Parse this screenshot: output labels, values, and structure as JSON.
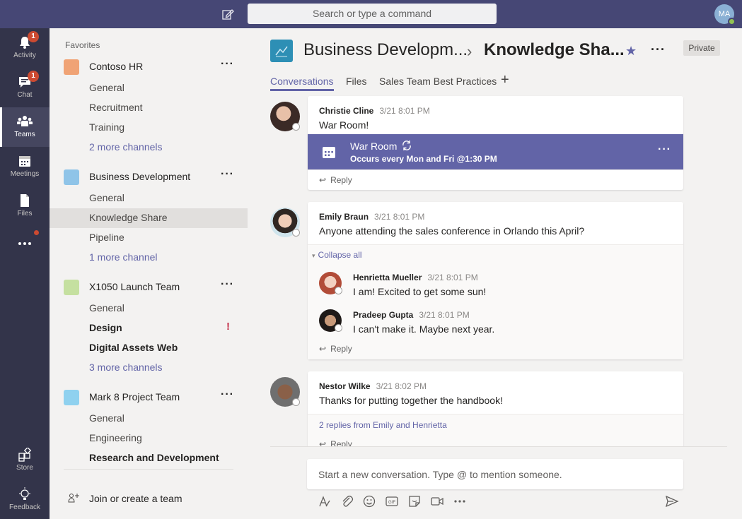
{
  "topbar": {
    "search_placeholder": "Search or type a command",
    "me_initials": "MA"
  },
  "rail": {
    "items": [
      {
        "label": "Activity",
        "badge": "1"
      },
      {
        "label": "Chat",
        "badge": "1"
      },
      {
        "label": "Teams"
      },
      {
        "label": "Meetings"
      },
      {
        "label": "Files"
      },
      {
        "label": "Store"
      },
      {
        "label": "Feedback"
      }
    ]
  },
  "sidebar": {
    "favorites_label": "Favorites",
    "teams": [
      {
        "name": "Contoso HR",
        "color": "#f0a375",
        "channels": [
          "General",
          "Recruitment",
          "Training"
        ],
        "more": "2 more channels"
      },
      {
        "name": "Business Development",
        "color": "#8fc4e8",
        "channels": [
          "General",
          "Knowledge Share",
          "Pipeline"
        ],
        "more": "1 more channel"
      },
      {
        "name": "X1050 Launch Team",
        "color": "#c5e0a0",
        "channels": [
          "General",
          "Design",
          "Digital Assets Web"
        ],
        "more": "3 more channels"
      },
      {
        "name": "Mark 8 Project Team",
        "color": "#8fd1ef",
        "channels": [
          "General",
          "Engineering",
          "Research and Development"
        ]
      }
    ],
    "join_label": "Join or create a team"
  },
  "header": {
    "team": "Business Developm...",
    "channel": "Knowledge Sha...",
    "privacy": "Private",
    "tabs": [
      "Conversations",
      "Files",
      "Sales Team Best Practices"
    ]
  },
  "posts": [
    {
      "author": "Christie Cline",
      "time": "3/21 8:01 PM",
      "text": "War Room!",
      "meeting": {
        "title": "War Room",
        "schedule": "Occurs every Mon and Fri @1:30 PM"
      },
      "reply": "Reply"
    },
    {
      "author": "Emily Braun",
      "time": "3/21 8:01 PM",
      "text": "Anyone attending the sales conference in Orlando this April?",
      "collapse": "Collapse all",
      "replies": [
        {
          "author": "Henrietta Mueller",
          "time": "3/21 8:01 PM",
          "text": "I am! Excited to get some sun!"
        },
        {
          "author": "Pradeep Gupta",
          "time": "3/21 8:01 PM",
          "text": "I can't make it. Maybe next year."
        }
      ],
      "reply": "Reply"
    },
    {
      "author": "Nestor Wilke",
      "time": "3/21 8:02 PM",
      "text": "Thanks for putting together the handbook!",
      "replies_summary": "2 replies from Emily and Henrietta",
      "reply": "Reply"
    }
  ],
  "composer": {
    "placeholder": "Start a new conversation. Type @ to mention someone."
  },
  "colors": {
    "brand": "#6264a7",
    "topbar": "#464775",
    "rail": "#33344a",
    "badge": "#cc4a31"
  }
}
